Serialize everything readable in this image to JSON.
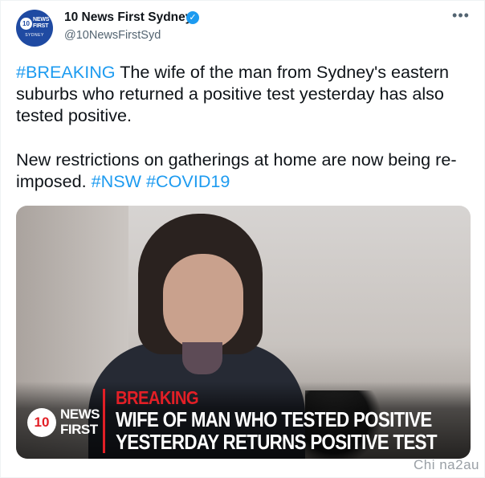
{
  "account": {
    "display_name": "10 News First Sydney",
    "handle": "@10NewsFirstSyd",
    "verified_icon": "✓",
    "more_icon": "•••",
    "avatar": {
      "logo_number": "10",
      "logo_text_1": "NEWS",
      "logo_text_2": "FIRST",
      "city": "SYDNEY"
    }
  },
  "tweet": {
    "line1_tag": "#BREAKING",
    "line1_text": " The wife of the man from Sydney's eastern suburbs who returned a positive test yesterday has also tested positive.",
    "line2_text": "New restrictions on gatherings at home are now being re-imposed. ",
    "tag_nsw": "#NSW",
    "tag_space": " ",
    "tag_covid": "#COVID19"
  },
  "media": {
    "logo_number": "10",
    "logo_line1": "NEWS",
    "logo_line2": "FIRST",
    "breaking": "BREAKING",
    "headline_line1": "WIFE OF MAN WHO TESTED POSITIVE",
    "headline_line2": "YESTERDAY RETURNS POSITIVE TEST"
  },
  "watermark": "Chi na2au",
  "colors": {
    "link": "#1d9bf0",
    "accent_red": "#e21f26",
    "brand_blue": "#1f4aa2"
  }
}
